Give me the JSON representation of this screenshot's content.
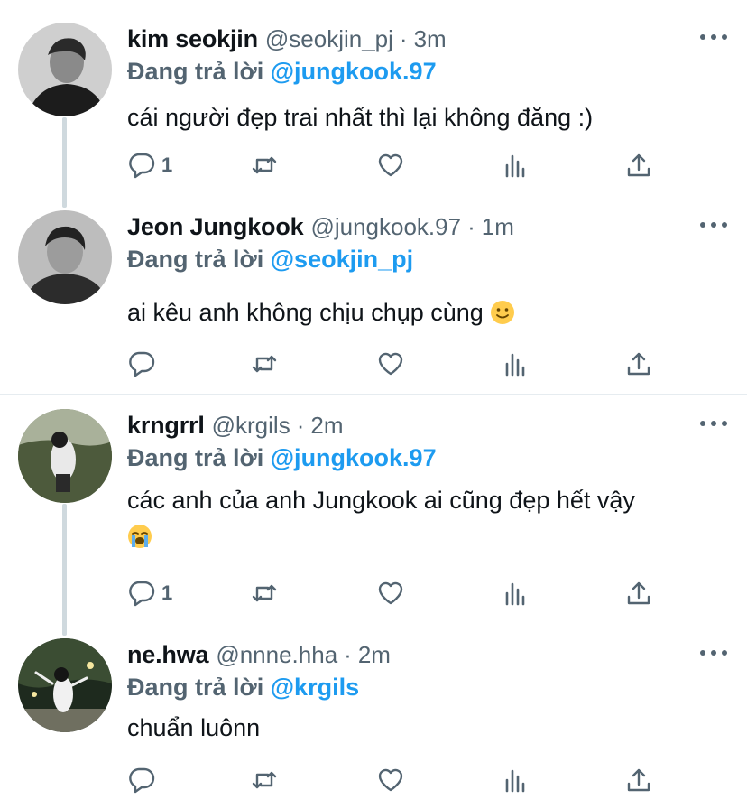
{
  "replying_to_label": "Đang trả lời",
  "tweets": [
    {
      "name": "kim seokjin",
      "handle": "@seokjin_pj",
      "separator": "·",
      "time": "3m",
      "reply_to": "@jungkook.97",
      "text": "cái người đẹp trai nhất thì lại không đăng :)",
      "emoji": "",
      "reply_count": "1"
    },
    {
      "name": "Jeon Jungkook",
      "handle": "@jungkook.97",
      "separator": "·",
      "time": "1m",
      "reply_to": "@seokjin_pj",
      "text": "ai kêu anh không chịu chụp cùng",
      "emoji": "slightly-smiling-face",
      "reply_count": ""
    },
    {
      "name": "krngrrl",
      "handle": "@krgils",
      "separator": "·",
      "time": "2m",
      "reply_to": "@jungkook.97",
      "text": "các anh của anh Jungkook ai cũng đẹp hết vậy",
      "emoji": "loudly-crying-face",
      "reply_count": "1"
    },
    {
      "name": "ne.hwa",
      "handle": "@nnne.hha",
      "separator": "·",
      "time": "2m",
      "reply_to": "@krgils",
      "text": "chuẩn luônn",
      "emoji": "",
      "reply_count": ""
    }
  ],
  "icons": [
    "reply-icon",
    "retweet-icon",
    "like-icon",
    "analytics-icon",
    "share-icon",
    "more-icon"
  ],
  "colors": {
    "mention": "#1d9bf0",
    "secondary_text": "#536471",
    "thread_line": "#cfd9de"
  }
}
